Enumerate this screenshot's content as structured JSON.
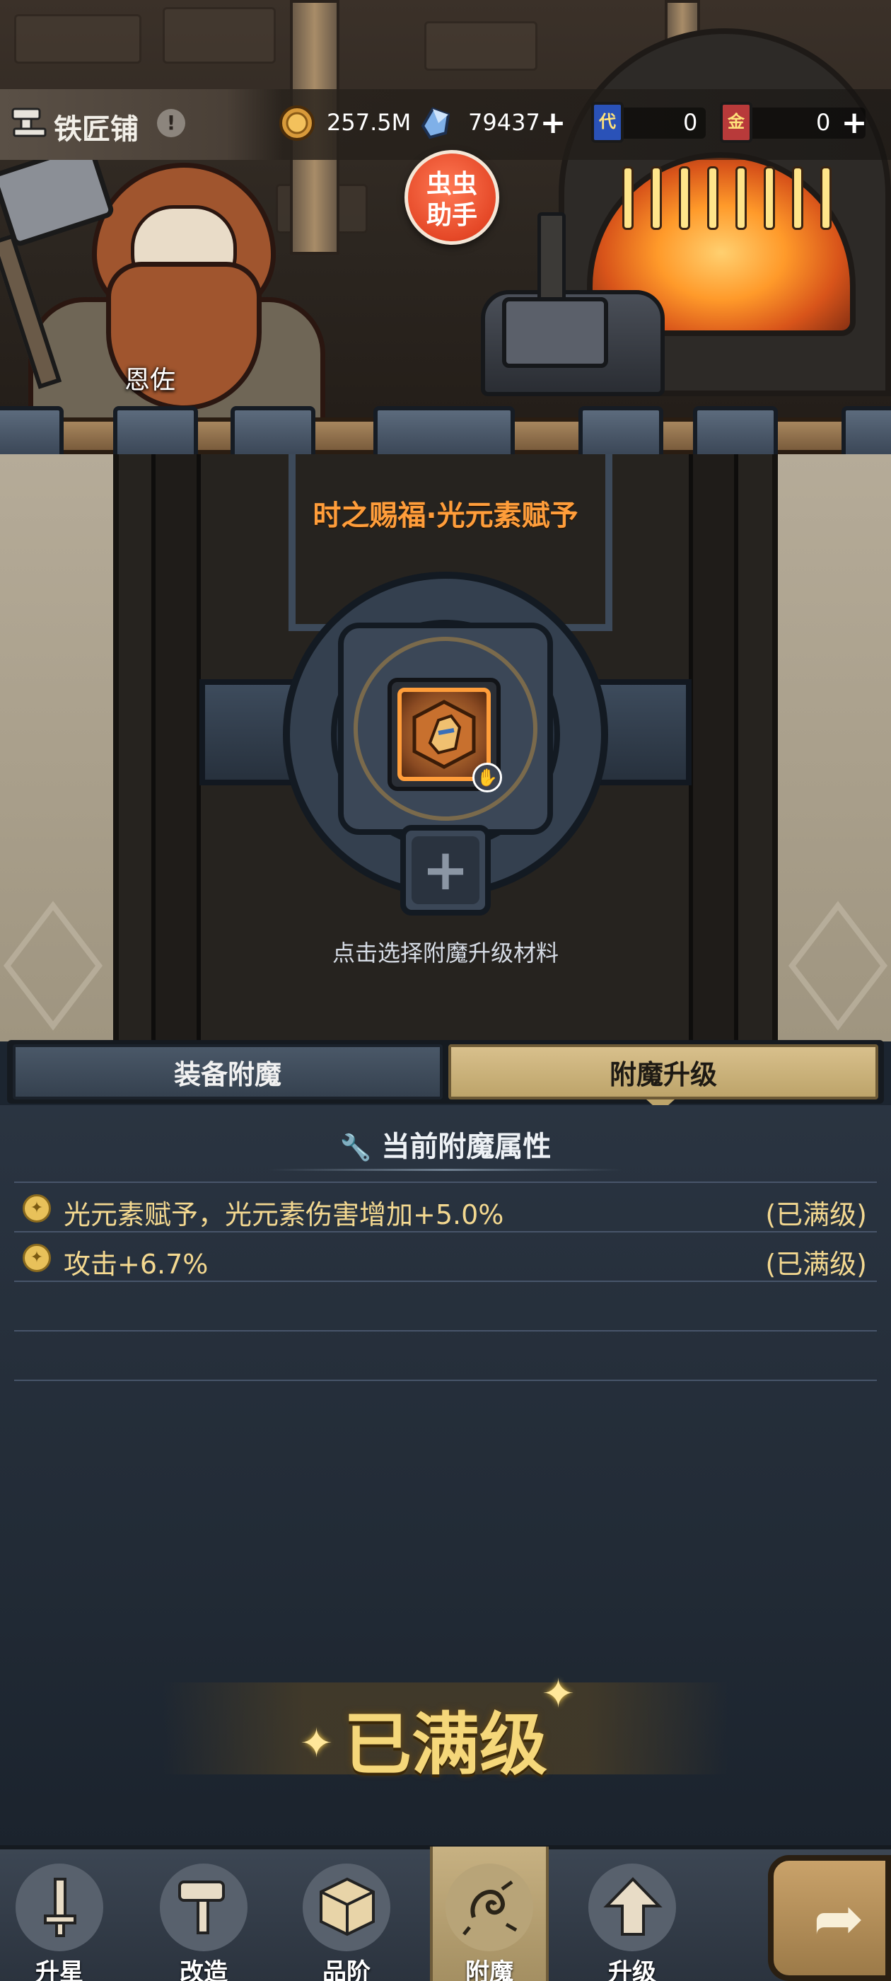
{
  "header": {
    "shop_title": "铁匠铺",
    "info_icon": "!",
    "resources": {
      "gold": "257.5M",
      "crystal": "79437",
      "card_a_label": "代",
      "card_a_count": "0",
      "card_b_label": "金",
      "card_b_count": "0",
      "plus": "+"
    }
  },
  "assistant": {
    "line1": "虫虫",
    "line2": "助手"
  },
  "npc": {
    "name": "恩佐"
  },
  "forge": {
    "recipe_title": "时之赐福·光元素赋予",
    "add_symbol": "+",
    "hint": "点击选择附魔升级材料"
  },
  "tabs": {
    "enchant": "装备附魔",
    "upgrade": "附魔升级"
  },
  "attributes": {
    "header": "当前附魔属性",
    "items": [
      {
        "text": "光元素赋予，光元素伤害增加+5.0%",
        "status": "(已满级)"
      },
      {
        "text": "攻击+6.7%",
        "status": "(已满级)"
      }
    ]
  },
  "max_level_banner": "已满级",
  "bottom_nav": {
    "star": "升星",
    "modify": "改造",
    "rank": "品阶",
    "enchant": "附魔",
    "upgrade": "升级"
  },
  "colors": {
    "accent_orange": "#ff9d3a",
    "attr_text": "#f3d890",
    "tab_active": "#bda46a",
    "panel_bg": "#222b36"
  },
  "icons": {
    "shop": "anvil-icon",
    "gold": "gold-coin-icon",
    "crystal": "crystal-icon",
    "attr": "star-badge-icon",
    "hand": "hand-icon",
    "next": "forward-arrow-icon"
  }
}
